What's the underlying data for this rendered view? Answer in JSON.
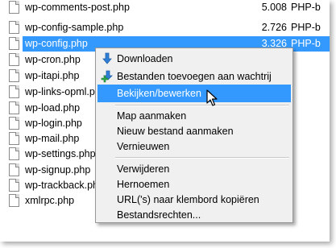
{
  "files": [
    {
      "name": "wp-comments-post.php",
      "size": "5.008",
      "type": "PHP-b"
    },
    {
      "name": "wp-config-sample.php",
      "size": "2.726",
      "type": "PHP-b"
    },
    {
      "name": "wp-config.php",
      "size": "3.326",
      "type": "PHP-b",
      "selected": true
    },
    {
      "name": "wp-cron.php",
      "size": "",
      "type": ""
    },
    {
      "name": "wp-itapi.php",
      "size": "",
      "type": ""
    },
    {
      "name": "wp-links-opml.php",
      "size": "",
      "type": ""
    },
    {
      "name": "wp-load.php",
      "size": "",
      "type": ""
    },
    {
      "name": "wp-login.php",
      "size": "",
      "type": ""
    },
    {
      "name": "wp-mail.php",
      "size": "",
      "type": ""
    },
    {
      "name": "wp-settings.php",
      "size": "",
      "type": ""
    },
    {
      "name": "wp-signup.php",
      "size": "",
      "type": ""
    },
    {
      "name": "wp-trackback.php",
      "size": "",
      "type": ""
    },
    {
      "name": "xmlrpc.php",
      "size": "",
      "type": ""
    }
  ],
  "context_menu": {
    "items": [
      {
        "label": "Downloaden",
        "icon": "download-arrow-icon"
      },
      {
        "label": "Bestanden toevoegen aan wachtrij",
        "icon": "add-to-queue-icon"
      },
      {
        "label": "Bekijken/bewerken",
        "highlighted": true
      },
      {
        "label": "Map aanmaken"
      },
      {
        "label": "Nieuw bestand aanmaken"
      },
      {
        "label": "Vernieuwen"
      },
      {
        "label": "Verwijderen"
      },
      {
        "label": "Hernoemen"
      },
      {
        "label": "URL('s) naar klembord kopiëren"
      },
      {
        "label": "Bestandsrechten..."
      }
    ]
  },
  "colors": {
    "selection": "#3399ff",
    "menu_bg": "#f0f0f0",
    "icon_blue": "#2f7fd8",
    "icon_green": "#2fa84a"
  }
}
